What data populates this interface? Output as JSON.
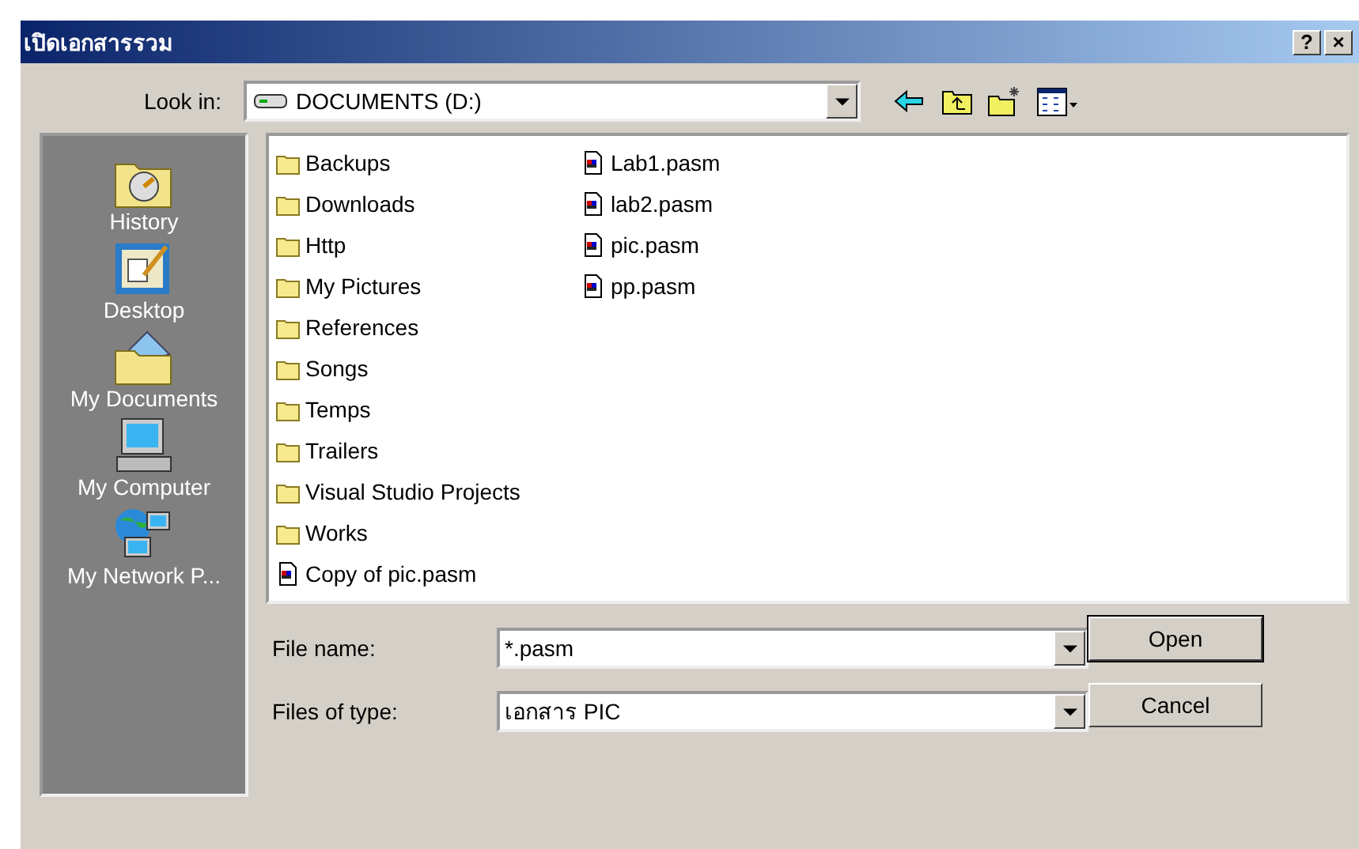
{
  "window": {
    "title": "เปิดเอกสารรวม",
    "help_button": "?",
    "close_button": "×"
  },
  "look_in": {
    "label": "Look in:",
    "value": "DOCUMENTS (D:)"
  },
  "places": [
    {
      "label": "History",
      "kind": "history"
    },
    {
      "label": "Desktop",
      "kind": "desktop"
    },
    {
      "label": "My Documents",
      "kind": "documents"
    },
    {
      "label": "My Computer",
      "kind": "computer"
    },
    {
      "label": "My Network P...",
      "kind": "network"
    }
  ],
  "files": [
    {
      "name": "Backups",
      "kind": "folder"
    },
    {
      "name": "Downloads",
      "kind": "folder"
    },
    {
      "name": "Http",
      "kind": "folder"
    },
    {
      "name": "My Pictures",
      "kind": "folder"
    },
    {
      "name": "References",
      "kind": "folder"
    },
    {
      "name": "Songs",
      "kind": "folder"
    },
    {
      "name": "Temps",
      "kind": "folder"
    },
    {
      "name": "Trailers",
      "kind": "folder"
    },
    {
      "name": "Visual Studio Projects",
      "kind": "folder"
    },
    {
      "name": "Works",
      "kind": "folder"
    },
    {
      "name": "Copy of pic.pasm",
      "kind": "file"
    },
    {
      "name": "Lab1.pasm",
      "kind": "file"
    },
    {
      "name": "lab2.pasm",
      "kind": "file"
    },
    {
      "name": "pic.pasm",
      "kind": "file"
    },
    {
      "name": "pp.pasm",
      "kind": "file"
    }
  ],
  "file_name": {
    "label": "File name:",
    "value": "*.pasm"
  },
  "file_type": {
    "label": "Files of type:",
    "value": "เอกสาร PIC"
  },
  "buttons": [
    "Open",
    "Cancel"
  ]
}
